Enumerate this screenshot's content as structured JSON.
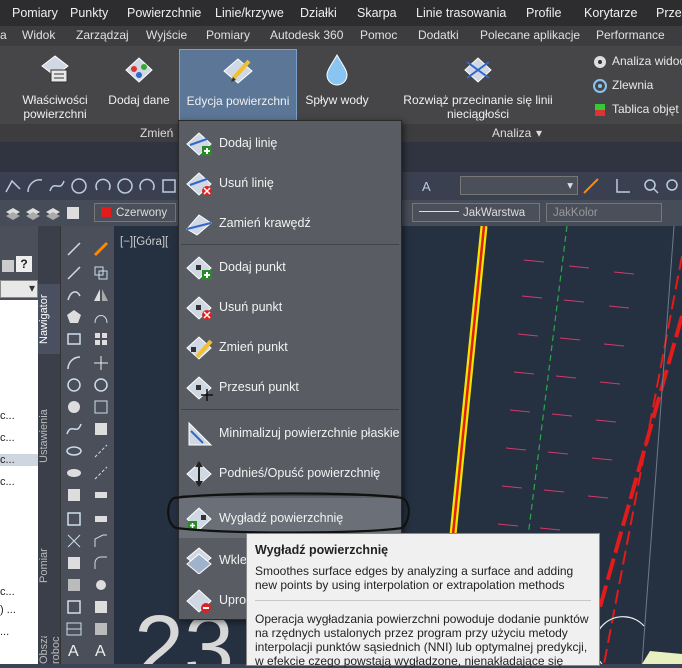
{
  "menubar": {
    "items": [
      "Pomiary",
      "Punkty",
      "Powierzchnie",
      "Linie/krzywe",
      "Działki",
      "Skarpa",
      "Linie trasowania",
      "Profile",
      "Korytarze",
      "Przek"
    ]
  },
  "ribbon_tabs": [
    "a",
    "Widok",
    "Zarządzaj",
    "Wyjście",
    "Pomiary",
    "Autodesk 360",
    "Pomoc",
    "Dodatki",
    "Polecane aplikacje",
    "Performance"
  ],
  "ribbon": {
    "btn_properties": "Właściwości",
    "btn_properties2": "powierzchni",
    "btn_adddata": "Dodaj dane",
    "btn_edit": "Edycja powierzchni",
    "btn_water": "Spływ wody",
    "btn_resolve": "Rozwiąż przecinanie się linii nieciągłości",
    "analysis_items": [
      "Analiza widoc",
      "Zlewnia",
      "Tablica objęt"
    ],
    "panel_modify": "Zmień",
    "panel_analysis": "Analiza"
  },
  "toolbar": {
    "color_value": "Czerwony",
    "linetype_value": "JakWarstwa",
    "color2_value": "JakKolor"
  },
  "side_tabs": [
    "Nawigator",
    "Ustawienia",
    "Pomiar",
    "Obszar roboczy"
  ],
  "left_list": [
    "c...",
    "c...",
    "c...",
    "c...",
    "c...",
    ") ...",
    "..."
  ],
  "viewport_label": "[−][Góra][",
  "dropdown": {
    "items": [
      {
        "label": "Dodaj linię",
        "icon": "add-line-icon"
      },
      {
        "label": "Usuń linię",
        "icon": "delete-line-icon"
      },
      {
        "label": "Zamień krawędź",
        "icon": "swap-edge-icon"
      },
      {
        "label": "Dodaj punkt",
        "icon": "add-point-icon"
      },
      {
        "label": "Usuń punkt",
        "icon": "delete-point-icon"
      },
      {
        "label": "Zmień punkt",
        "icon": "modify-point-icon"
      },
      {
        "label": "Przesuń punkt",
        "icon": "move-point-icon"
      },
      {
        "label": "Minimalizuj powierzchnie płaskie",
        "icon": "minimize-flat-icon"
      },
      {
        "label": "Podnieś/Opuść powierzchnię",
        "icon": "raise-lower-icon"
      },
      {
        "label": "Wygładź powierzchnię",
        "icon": "smooth-surface-icon"
      },
      {
        "label": "Wklej",
        "icon": "paste-surface-icon"
      },
      {
        "label": "Upros",
        "icon": "simplify-surface-icon"
      }
    ]
  },
  "tooltip": {
    "title": "Wygładź powierzchnię",
    "description_en": "Smoothes surface edges by analyzing a surface and adding new points by using interpolation or extrapolation methods",
    "description_pl": "Operacja wygładzania powierzchni powoduje dodanie punktów na rzędnych ustalonych przez program przy użyciu metody interpolacji punktów sąsiednich (NNI) lub optymalnej predykcji, w efekcie czego powstają wygładzone, nienakładające się"
  },
  "drawing_text": "23",
  "colors": {
    "accent_yellow": "#f2e600",
    "accent_red": "#e21b1b",
    "menu_bg": "#2d2d30",
    "dropdown_bg": "#595d63"
  }
}
